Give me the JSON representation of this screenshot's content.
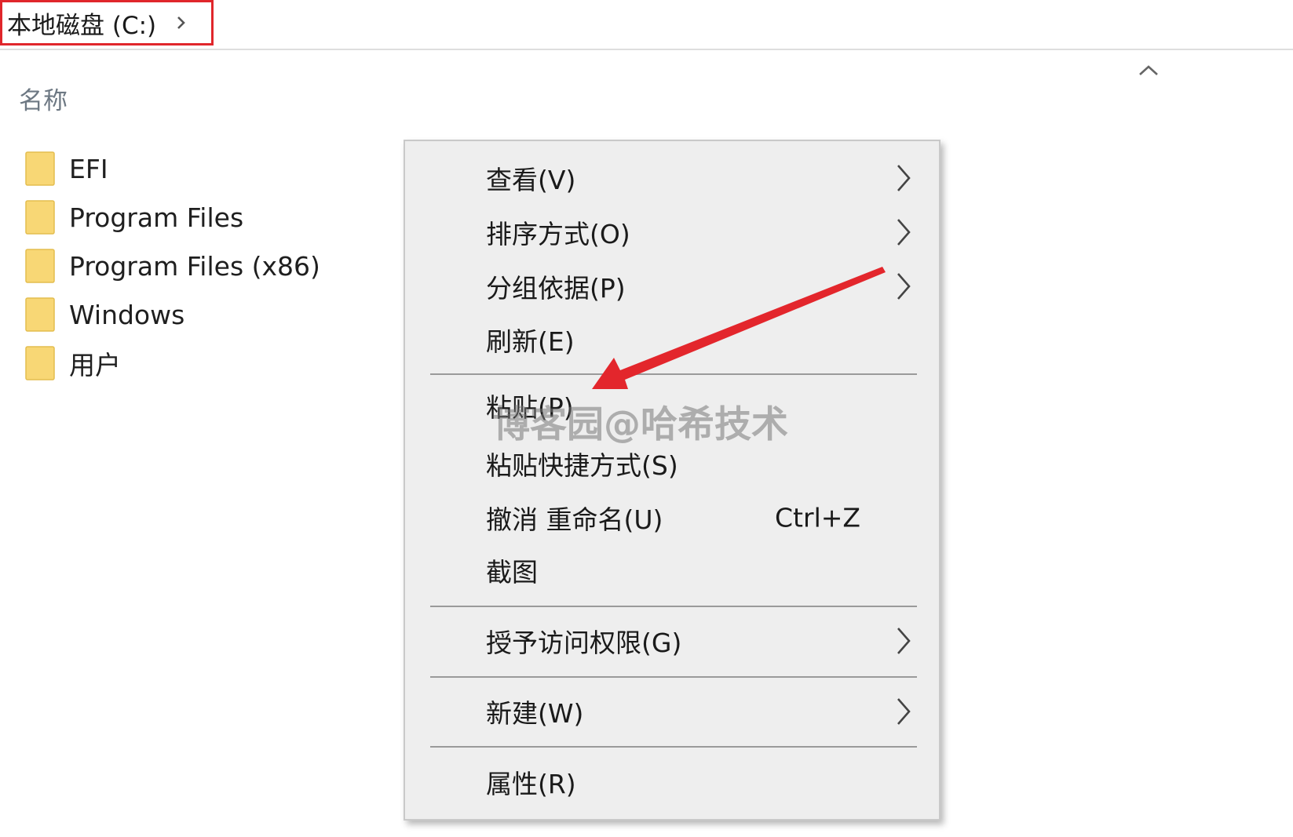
{
  "address_bar": {
    "breadcrumb": "本地磁盘 (C:)"
  },
  "file_list": {
    "column_header": "名称",
    "items": [
      {
        "name": "EFI",
        "icon": "folder-icon"
      },
      {
        "name": "Program Files",
        "icon": "folder-icon"
      },
      {
        "name": "Program Files (x86)",
        "icon": "folder-icon"
      },
      {
        "name": "Windows",
        "icon": "folder-icon"
      },
      {
        "name": "用户",
        "icon": "folder-icon"
      }
    ]
  },
  "context_menu": {
    "items": [
      {
        "label": "查看(V)",
        "submenu": true
      },
      {
        "label": "排序方式(O)",
        "submenu": true
      },
      {
        "label": "分组依据(P)",
        "submenu": true
      },
      {
        "label": "刷新(E)",
        "submenu": false
      },
      {
        "label": "粘贴(P)",
        "submenu": false
      },
      {
        "label": "粘贴快捷方式(S)",
        "submenu": false
      },
      {
        "label": "撤消 重命名(U)",
        "shortcut": "Ctrl+Z",
        "submenu": false
      },
      {
        "label": "截图",
        "submenu": false
      },
      {
        "label": "授予访问权限(G)",
        "submenu": true
      },
      {
        "label": "新建(W)",
        "submenu": true
      },
      {
        "label": "属性(R)",
        "submenu": false
      }
    ]
  },
  "watermark": "博客园@哈希技术",
  "colors": {
    "highlight_border": "#e0262b",
    "annotation_arrow": "#e3262c",
    "menu_background": "#eeeeee",
    "folder_yellow": "#f8d775"
  }
}
